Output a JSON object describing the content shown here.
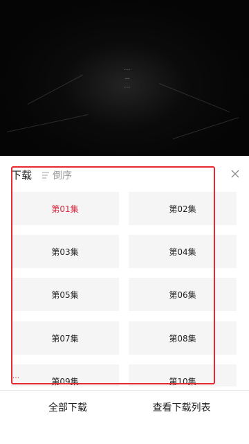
{
  "header": {
    "title": "下载",
    "sort_label": "倒序"
  },
  "episodes": [
    {
      "label": "第01集",
      "selected": true
    },
    {
      "label": "第02集",
      "selected": false
    },
    {
      "label": "第03集",
      "selected": false
    },
    {
      "label": "第04集",
      "selected": false
    },
    {
      "label": "第05集",
      "selected": false
    },
    {
      "label": "第06集",
      "selected": false
    },
    {
      "label": "第07集",
      "selected": false
    },
    {
      "label": "第08集",
      "selected": false
    },
    {
      "label": "第09集",
      "selected": false
    },
    {
      "label": "第10集",
      "selected": false
    }
  ],
  "footer": {
    "download_all_label": "全部下载",
    "view_list_label": "查看下载列表"
  },
  "colors": {
    "accent": "#d8283c",
    "highlight": "#e8282f",
    "tile_bg": "#f5f5f5"
  },
  "icons": [
    "sort-icon",
    "close-icon"
  ]
}
